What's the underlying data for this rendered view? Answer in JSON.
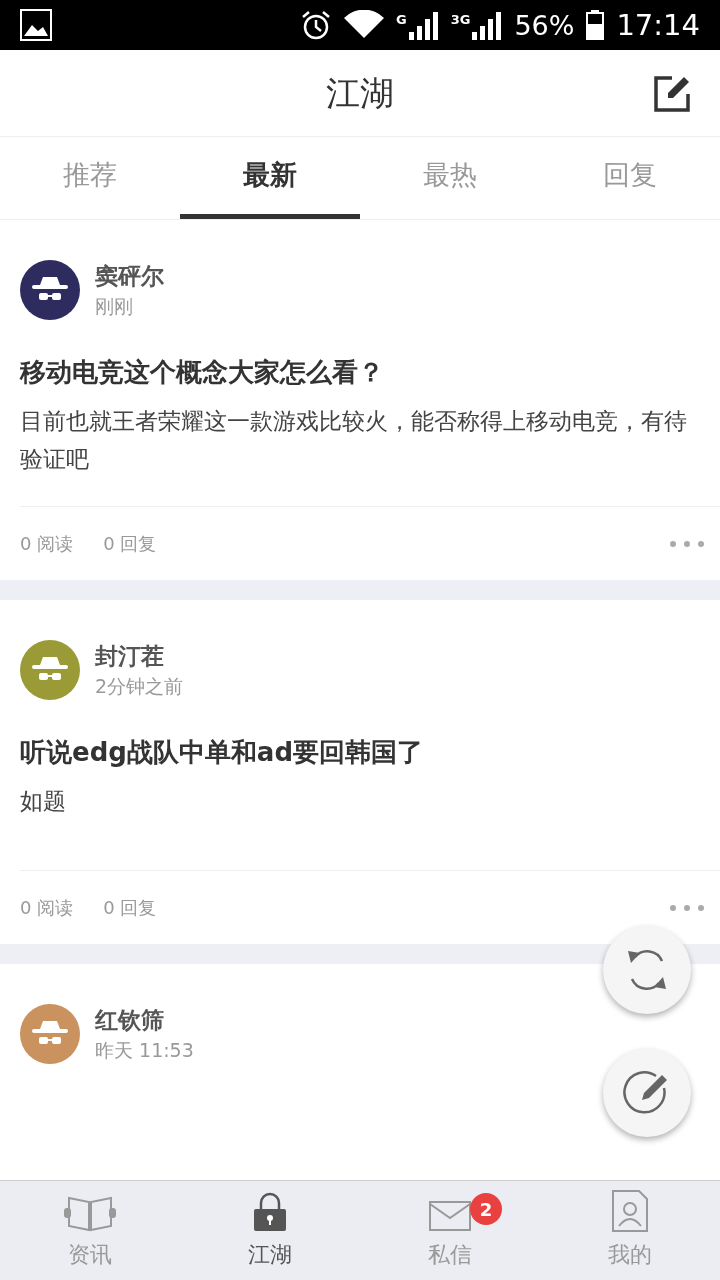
{
  "status_bar": {
    "battery": "56%",
    "time": "17:14",
    "network_1": "G",
    "network_2": "3G"
  },
  "header": {
    "title": "江湖"
  },
  "tabs": [
    {
      "label": "推荐",
      "selected": false
    },
    {
      "label": "最新",
      "selected": true
    },
    {
      "label": "最热",
      "selected": false
    },
    {
      "label": "回复",
      "selected": false
    }
  ],
  "posts": [
    {
      "author": "窦砰尔",
      "time": "刚刚",
      "color": "#2e2c5e",
      "title": "移动电竞这个概念大家怎么看？",
      "body": "目前也就王者荣耀这一款游戏比较火，能否称得上移动电竞，有待验证吧",
      "reads": "0 阅读",
      "replies": "0 回复"
    },
    {
      "author": "封汀茬",
      "time": "2分钟之前",
      "color": "#9a9a36",
      "title": "听说edg战队中单和ad要回韩国了",
      "body": "如题",
      "reads": "0 阅读",
      "replies": "0 回复"
    },
    {
      "author": "红钦筛",
      "time": "昨天 11:53",
      "color": "#c9925e"
    }
  ],
  "bottom_nav": [
    {
      "label": "资讯",
      "selected": false,
      "kind": "book"
    },
    {
      "label": "江湖",
      "selected": true,
      "kind": "lock"
    },
    {
      "label": "私信",
      "selected": false,
      "kind": "mail",
      "badge": "2"
    },
    {
      "label": "我的",
      "selected": false,
      "kind": "profile"
    }
  ]
}
